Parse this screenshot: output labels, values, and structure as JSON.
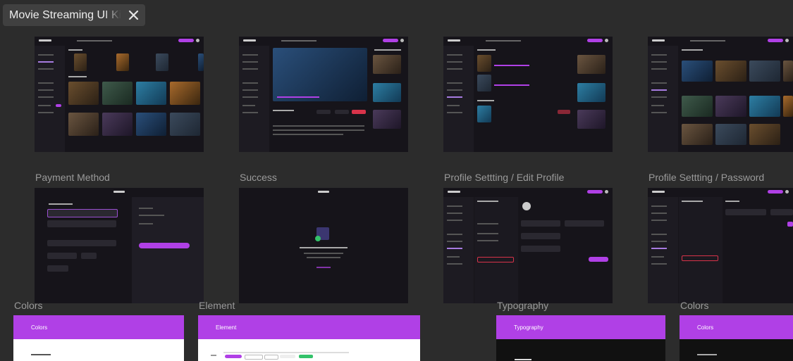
{
  "tab": {
    "title": "Movie Streaming UI Kit",
    "close_icon": "close-icon"
  },
  "frames_row2": [
    {
      "label": "Payment Method"
    },
    {
      "label": "Success"
    },
    {
      "label": "Profile Settting / Edit Profile"
    },
    {
      "label": "Profile Settting / Password"
    }
  ],
  "frames_row3": [
    {
      "label": "Colors",
      "header": "Colors"
    },
    {
      "label": "Element",
      "header": "Element"
    },
    {
      "label": "Typography",
      "header": "Typography"
    },
    {
      "label": "Colors",
      "header": "Colors"
    }
  ],
  "colors": {
    "canvas": "#2c2c2c",
    "frame": "#16141a",
    "accent": "#b040e6",
    "danger": "#d8334a"
  }
}
